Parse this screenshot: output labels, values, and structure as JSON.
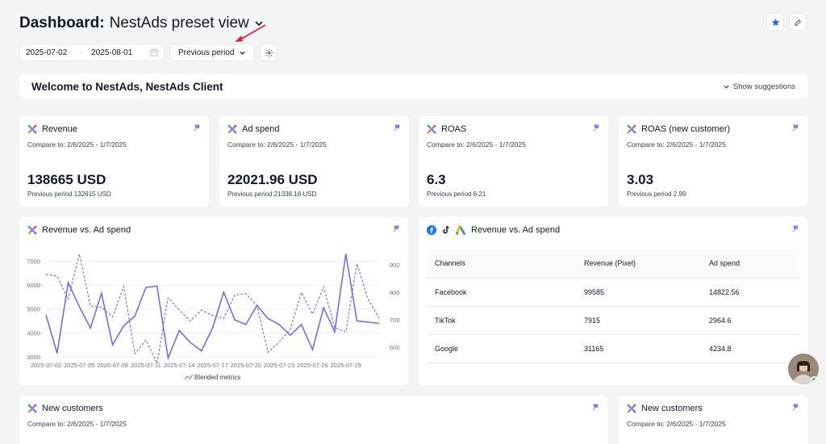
{
  "header": {
    "title": "Dashboard:",
    "view_name": "NestAds preset view"
  },
  "date_range": {
    "start": "2025-07-02",
    "end": "2025-08-01"
  },
  "period_label": "Previous period",
  "welcome": {
    "text": "Welcome to NestAds, NestAds Client",
    "suggestions": "Show suggestions"
  },
  "kpis": [
    {
      "title": "Revenue",
      "compare": "Compare to: 2/6/2025 - 1/7/2025",
      "value": "138665 USD",
      "previous": "Previous period 132615 USD"
    },
    {
      "title": "Ad spend",
      "compare": "Compare to: 2/6/2025 - 1/7/2025",
      "value": "22021.96 USD",
      "previous": "Previous period 21338.16 USD"
    },
    {
      "title": "ROAS",
      "compare": "Compare to: 2/6/2025 - 1/7/2025",
      "value": "6.3",
      "previous": "Previous period 6.21"
    },
    {
      "title": "ROAS (new customer)",
      "compare": "Compare to: 2/6/2025 - 1/7/2025",
      "value": "3.03",
      "previous": "Previous period 2.99"
    }
  ],
  "chart_card": {
    "title": "Revenue vs. Ad spend"
  },
  "chart_data": {
    "type": "line",
    "title": "Revenue vs. Ad spend",
    "x": [
      "2025-07-02",
      "2025-07-03",
      "2025-07-04",
      "2025-07-05",
      "2025-07-06",
      "2025-07-07",
      "2025-07-08",
      "2025-07-09",
      "2025-07-10",
      "2025-07-11",
      "2025-07-12",
      "2025-07-13",
      "2025-07-14",
      "2025-07-15",
      "2025-07-16",
      "2025-07-17",
      "2025-07-18",
      "2025-07-19",
      "2025-07-20",
      "2025-07-21",
      "2025-07-22",
      "2025-07-23",
      "2025-07-24",
      "2025-07-25",
      "2025-07-26",
      "2025-07-27",
      "2025-07-28",
      "2025-07-29",
      "2025-07-30",
      "2025-07-31",
      "2025-08-01"
    ],
    "xticks": [
      "2025-07-02",
      "2025-07-05",
      "2025-07-08",
      "2025-07-11",
      "2025-07-14",
      "2025-07-17",
      "2025-07-20",
      "2025-07-23",
      "2025-07-26",
      "2025-07-29"
    ],
    "y_left": {
      "ticks": [
        3000,
        4000,
        5000,
        6000,
        7000
      ],
      "range": [
        2900,
        7350
      ]
    },
    "y_right": {
      "ticks": [
        600,
        700,
        800,
        900
      ],
      "range": [
        555,
        945
      ]
    },
    "legend": "Blended metrics",
    "series": [
      {
        "values": [
          4750,
          3150,
          6100,
          5100,
          4200,
          5650,
          3500,
          4300,
          4700,
          5900,
          5950,
          2950,
          4100,
          3600,
          3250,
          4200,
          5700,
          4550,
          4350,
          5150,
          4600,
          4350,
          3900,
          4350,
          3300,
          5050,
          4050,
          7300,
          4500,
          4450,
          4400
        ],
        "axis": "left",
        "style": "solid"
      },
      {
        "values": [
          865,
          860,
          775,
          940,
          750,
          745,
          710,
          822,
          575,
          625,
          540,
          780,
          735,
          695,
          735,
          715,
          705,
          790,
          795,
          750,
          580,
          618,
          665,
          800,
          720,
          820,
          670,
          655,
          905,
          775,
          705
        ],
        "axis": "right",
        "style": "dashed"
      }
    ]
  },
  "table_card": {
    "title": "Revenue vs. Ad spend",
    "columns": [
      "Channels",
      "Revenue (Pixel)",
      "Ad spend"
    ],
    "rows": [
      [
        "Facebook",
        "99585",
        "14822.56"
      ],
      [
        "TikTok",
        "7915",
        "2964.6"
      ],
      [
        "Google",
        "31165",
        "4234.8"
      ]
    ]
  },
  "new_customers": [
    {
      "title": "New customers",
      "compare": "Compare to: 2/6/2025 - 1/7/2025"
    },
    {
      "title": "New customers",
      "compare": "Compare to: 2/6/2025 - 1/7/2025"
    }
  ],
  "colors": {
    "accent": "#7b68ee",
    "pin": "#8b7cf6",
    "facebook": "#1877f2",
    "google_yellow": "#fbbc04",
    "google_blue": "#4285f4",
    "red_arrow": "#e5202a"
  }
}
